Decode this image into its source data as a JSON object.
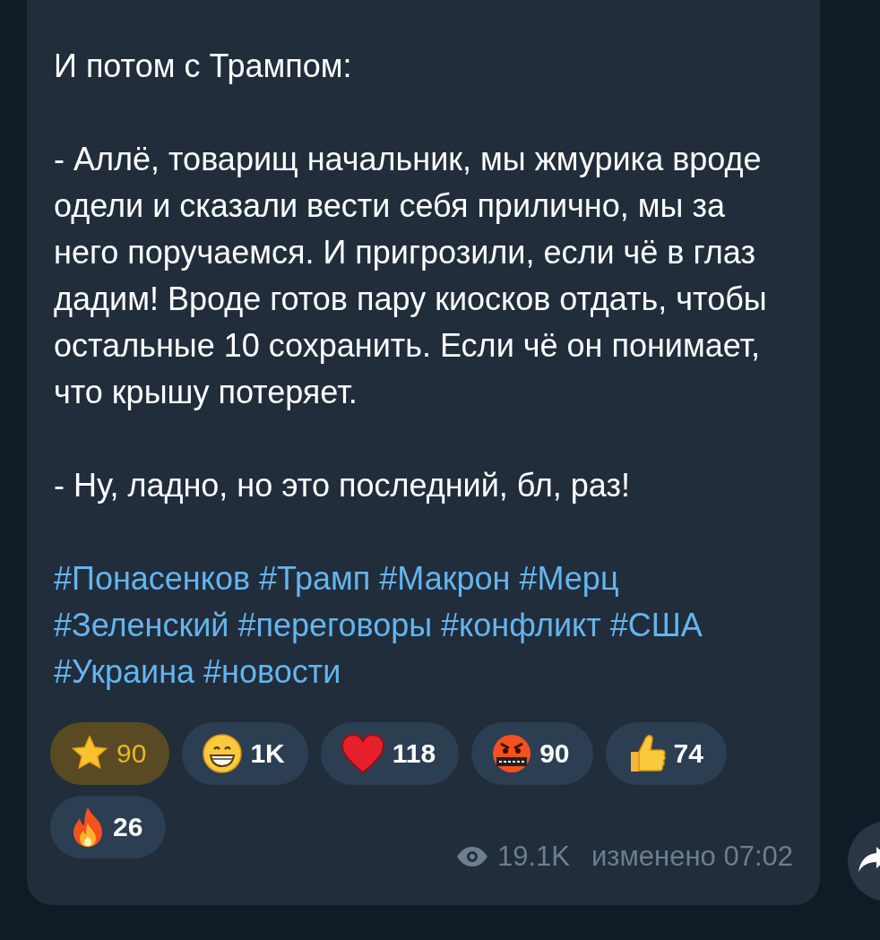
{
  "message": {
    "paragraphs": [
      "И потом с Трампом:",
      "- Аллё, товарищ начальник, мы жмурика вроде одели и сказали вести себя прилично, мы за него поручаемся. И пригрозили, если чё в глаз дадим! Вроде готов пару киосков отдать, чтобы остальные 10 сохранить. Если чё он понимает, что крышу потеряет.",
      "- Ну, ладно, но это последний, бл, раз!"
    ],
    "hashtags": [
      "#Понасенков",
      "#Трамп",
      "#Макрон",
      "#Мерц",
      "#Зеленский",
      "#переговоры",
      "#конфликт",
      "#США",
      "#Украина",
      "#новости"
    ],
    "reactions": [
      {
        "kind": "star",
        "count": "90",
        "selected": true
      },
      {
        "kind": "grin",
        "count": "1K",
        "selected": false
      },
      {
        "kind": "heart",
        "count": "118",
        "selected": false
      },
      {
        "kind": "angry",
        "count": "90",
        "selected": false
      },
      {
        "kind": "thumbs",
        "count": "74",
        "selected": false
      },
      {
        "kind": "fire",
        "count": "26",
        "selected": false
      }
    ],
    "views": "19.1K",
    "edited_time": "изменено 07:02"
  }
}
